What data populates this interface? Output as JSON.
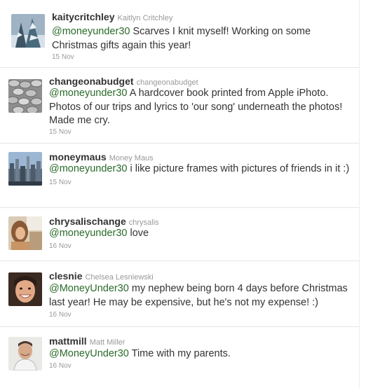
{
  "tweets": [
    {
      "screen_name": "kaitycritchley",
      "full_name": "Kaitlyn Critchley",
      "mention": "@moneyunder30",
      "body": " Scarves I knit myself! Working on some Christmas gifts again this year!",
      "time": "15 Nov",
      "avatar_icon": "winter-tree-photo-icon"
    },
    {
      "screen_name": "changeonabudget",
      "full_name": "changeonabudget",
      "mention": "@moneyunder30",
      "body": "  A hardcover book printed from Apple iPhoto. Photos of our trips and lyrics to 'our song' underneath the photos! Made me cry.",
      "time": "15 Nov",
      "avatar_icon": "coins-photo-icon"
    },
    {
      "screen_name": "moneymaus",
      "full_name": "Money Maus",
      "mention": "@moneyunder30",
      "body": " i like picture frames with pictures of friends in it :)",
      "time": "15 Nov",
      "avatar_icon": "city-skyline-photo-icon"
    },
    {
      "screen_name": "chrysalischange",
      "full_name": "chrysalis",
      "mention": "@moneyunder30",
      "body": " love",
      "time": "16 Nov",
      "avatar_icon": "person-photo-icon"
    },
    {
      "screen_name": "clesnie",
      "full_name": "Chelsea Lesniewski",
      "mention": "@MoneyUnder30",
      "body": " my nephew being born 4 days before Christmas last year! He may be expensive, but he's not my expense! :)",
      "time": "16 Nov",
      "avatar_icon": "smiling-woman-photo-icon"
    },
    {
      "screen_name": "mattmill",
      "full_name": "Matt Miller",
      "mention": "@MoneyUnder30",
      "body": " Time with my parents.",
      "time": "16 Nov",
      "avatar_icon": "man-portrait-photo-icon"
    }
  ]
}
